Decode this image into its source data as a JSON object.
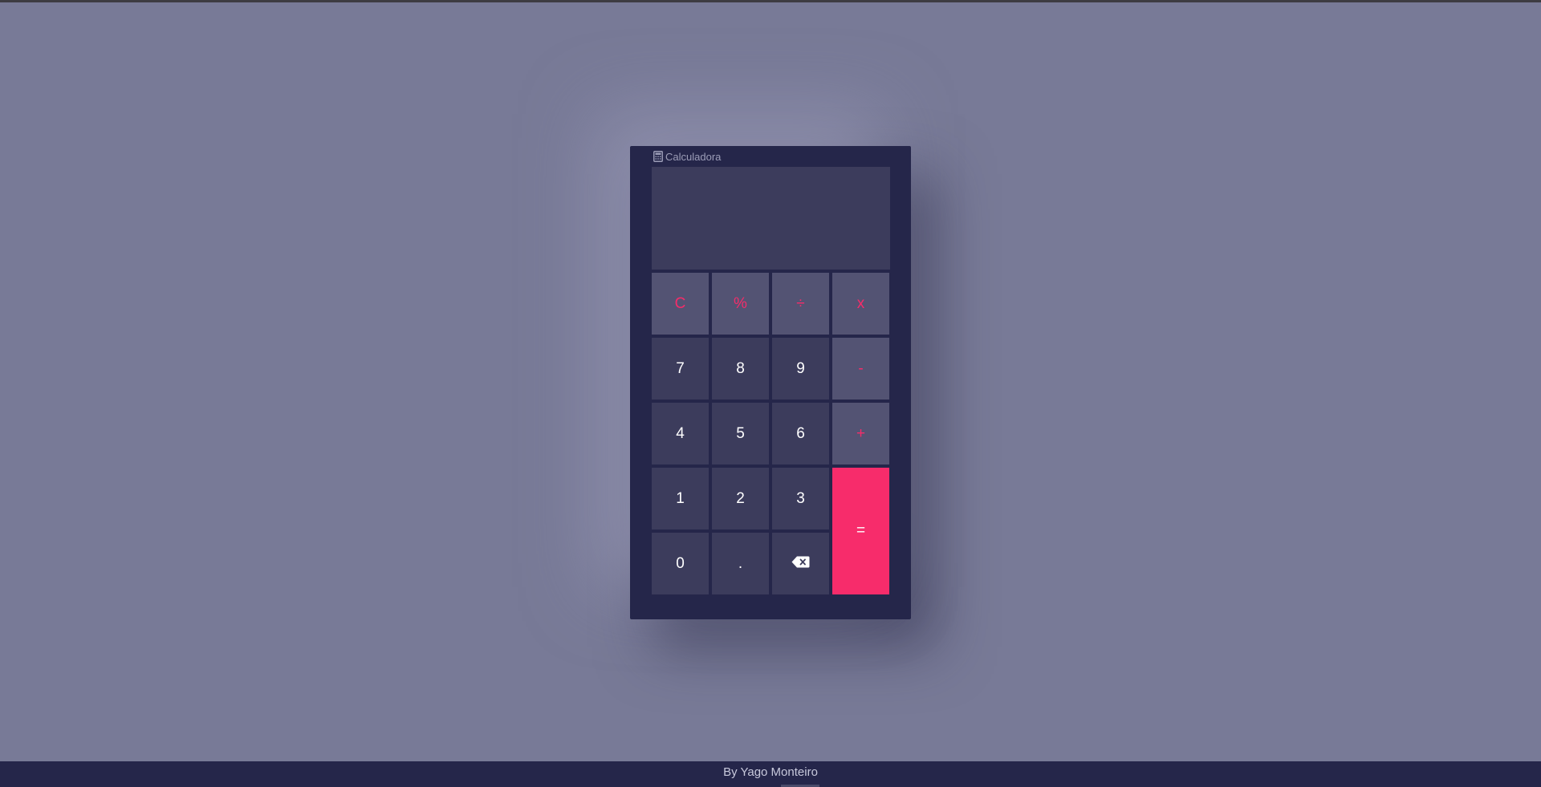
{
  "calculator": {
    "title": "Calculadora",
    "icon": "calculator-icon",
    "display_value": "",
    "keys": {
      "clear": "C",
      "percent": "%",
      "divide": "÷",
      "multiply": "x",
      "seven": "7",
      "eight": "8",
      "nine": "9",
      "minus": "-",
      "four": "4",
      "five": "5",
      "six": "6",
      "plus": "+",
      "one": "1",
      "two": "2",
      "three": "3",
      "equals": "=",
      "zero": "0",
      "dot": ".",
      "backspace_icon": "backspace-icon"
    }
  },
  "footer": {
    "credit": "By Yago Monteiro"
  },
  "colors": {
    "background": "#787a97",
    "panel": "#25264a",
    "key_number": "#3c3c5c",
    "key_operator": "#535373",
    "accent": "#f72c6b"
  }
}
